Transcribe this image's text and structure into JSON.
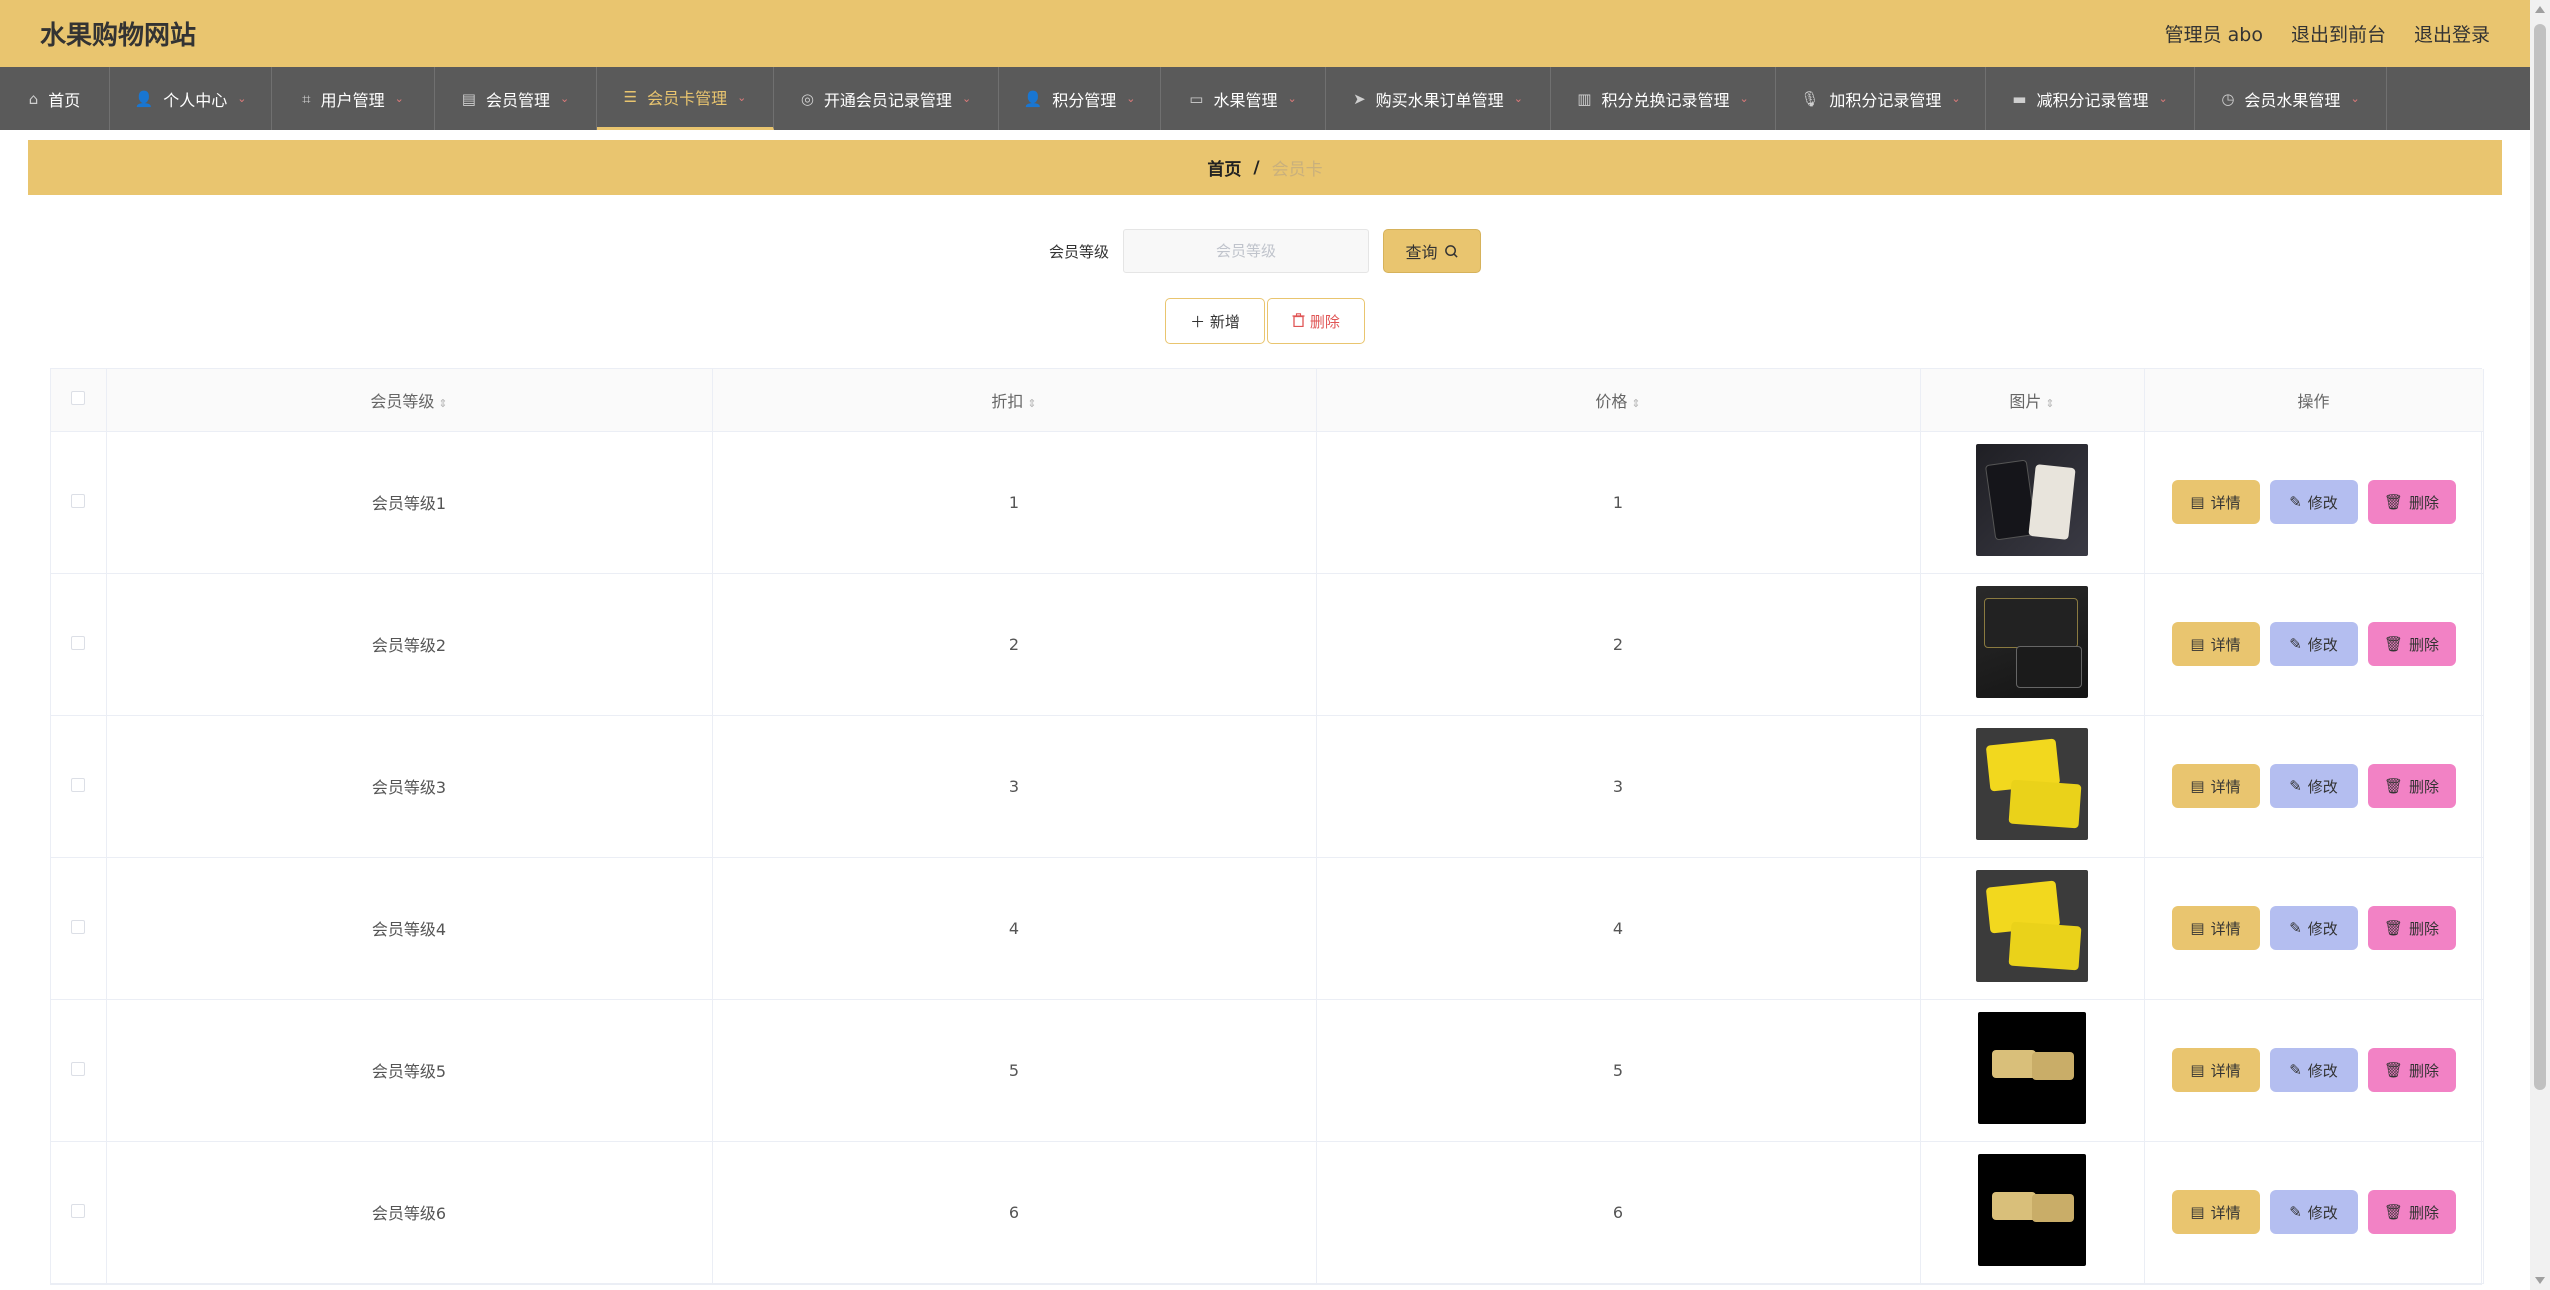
{
  "header": {
    "site_title": "水果购物网站",
    "admin_label": "管理员 abo",
    "back_to_front": "退出到前台",
    "logout": "退出登录"
  },
  "nav": {
    "items": [
      {
        "label": "首页",
        "icon": "home-icon",
        "has_dropdown": false,
        "active": false
      },
      {
        "label": "个人中心",
        "icon": "user-icon",
        "has_dropdown": true,
        "active": false
      },
      {
        "label": "用户管理",
        "icon": "crop-icon",
        "has_dropdown": true,
        "active": false
      },
      {
        "label": "会员管理",
        "icon": "list-icon",
        "has_dropdown": true,
        "active": false
      },
      {
        "label": "会员卡管理",
        "icon": "filter-icon",
        "has_dropdown": true,
        "active": true
      },
      {
        "label": "开通会员记录管理",
        "icon": "compass-icon",
        "has_dropdown": true,
        "active": false
      },
      {
        "label": "积分管理",
        "icon": "user-icon",
        "has_dropdown": true,
        "active": false
      },
      {
        "label": "水果管理",
        "icon": "briefcase-icon",
        "has_dropdown": true,
        "active": false
      },
      {
        "label": "购买水果订单管理",
        "icon": "send-icon",
        "has_dropdown": true,
        "active": false
      },
      {
        "label": "积分兑换记录管理",
        "icon": "chart-icon",
        "has_dropdown": true,
        "active": false
      },
      {
        "label": "加积分记录管理",
        "icon": "microphone-icon",
        "has_dropdown": true,
        "active": false
      },
      {
        "label": "减积分记录管理",
        "icon": "printer-icon",
        "has_dropdown": true,
        "active": false
      },
      {
        "label": "会员水果管理",
        "icon": "clock-icon",
        "has_dropdown": true,
        "active": false
      }
    ]
  },
  "breadcrumb": {
    "home": "首页",
    "separator": "/",
    "current": "会员卡"
  },
  "search": {
    "label": "会员等级",
    "placeholder": "会员等级",
    "value": "",
    "button_label": "查询"
  },
  "actions": {
    "add_label": "新增",
    "delete_label": "删除"
  },
  "table": {
    "columns": [
      "会员等级",
      "折扣",
      "价格",
      "图片",
      "操作"
    ],
    "rows": [
      {
        "level": "会员等级1",
        "discount": "1",
        "price": "1",
        "image": "dark"
      },
      {
        "level": "会员等级2",
        "discount": "2",
        "price": "2",
        "image": "dark2"
      },
      {
        "level": "会员等级3",
        "discount": "3",
        "price": "3",
        "image": "yellow"
      },
      {
        "level": "会员等级4",
        "discount": "4",
        "price": "4",
        "image": "yellow"
      },
      {
        "level": "会员等级5",
        "discount": "5",
        "price": "5",
        "image": "black"
      },
      {
        "level": "会员等级6",
        "discount": "6",
        "price": "6",
        "image": "black"
      }
    ],
    "row_actions": {
      "detail": "详情",
      "edit": "修改",
      "delete": "删除"
    }
  },
  "colors": {
    "accent": "#e9c56f",
    "nav_bg": "#5a5a5a",
    "edit_btn": "#b4bef0",
    "delete_btn": "#f282c5",
    "danger_text": "#e05555"
  }
}
